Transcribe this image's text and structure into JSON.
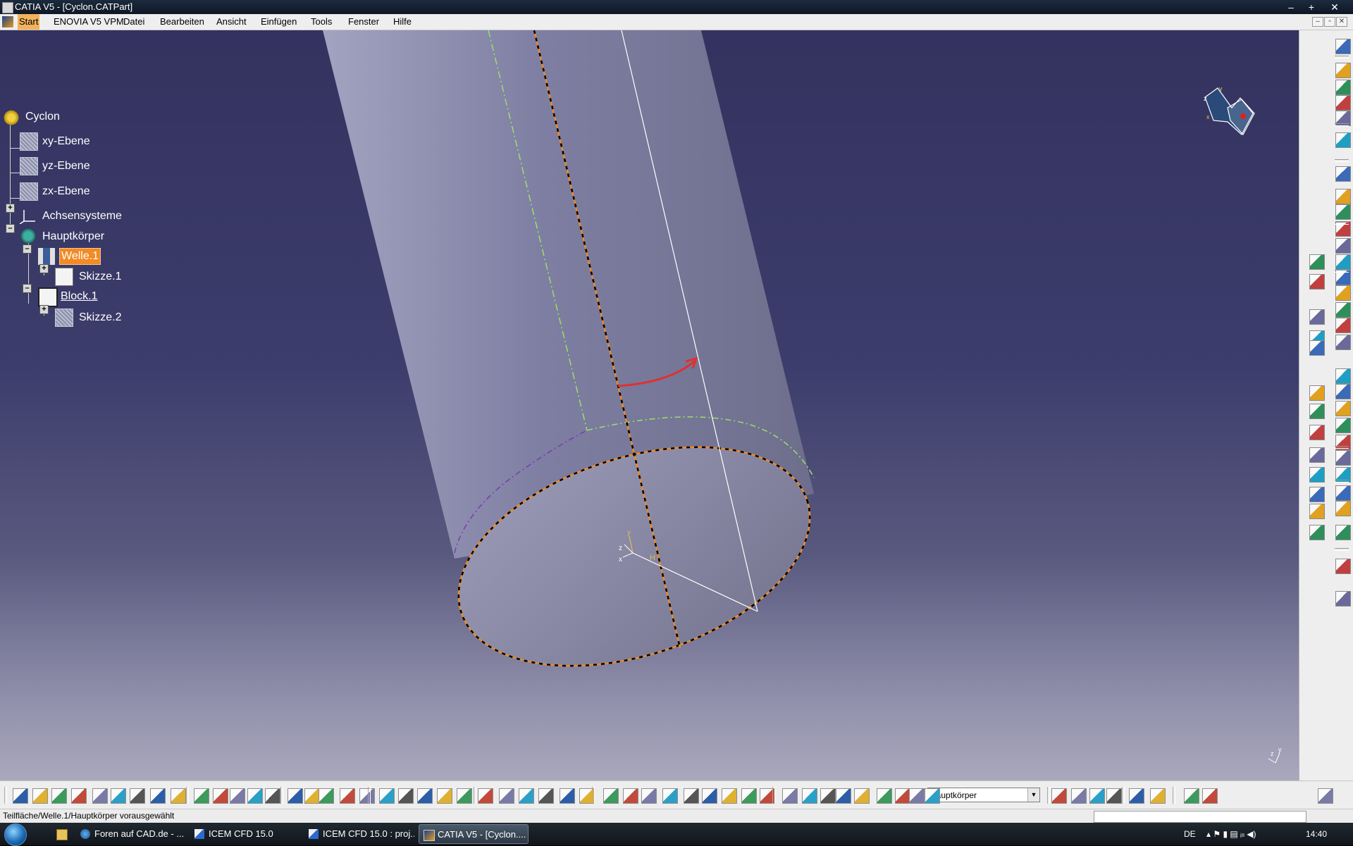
{
  "window": {
    "title": "CATIA V5 - [Cyclon.CATPart]",
    "controls": [
      "–",
      "+",
      "✕"
    ]
  },
  "menu": {
    "items": [
      "Start",
      "ENOVIA V5 VPM",
      "Datei",
      "Bearbeiten",
      "Ansicht",
      "Einfügen",
      "Tools",
      "Fenster",
      "Hilfe"
    ],
    "mdi_controls": [
      "–",
      "▫",
      "✕"
    ]
  },
  "spec_tree": {
    "root": "Cyclon",
    "planes": [
      "xy-Ebene",
      "yz-Ebene",
      "zx-Ebene"
    ],
    "axis_systems": "Achsensysteme",
    "main_body": "Hauptkörper",
    "shaft": "Welle.1",
    "shaft_sketch": "Skizze.1",
    "pad": "Block.1",
    "pad_sketch": "Skizze.2"
  },
  "compass_axes": {
    "x": "x",
    "y": "y",
    "z": "z"
  },
  "sketch_label": "H",
  "bottom_toolbar": {
    "body_select_value": "Hauptkörper"
  },
  "status": {
    "text": "Teilfläche/Welle.1/Hauptkörper vorausgewählt"
  },
  "taskbar": {
    "items": [
      {
        "label": "Foren auf CAD.de - ...",
        "icon": "browser-icon"
      },
      {
        "label": "ICEM CFD 15.0",
        "icon": "icem-icon"
      },
      {
        "label": "ICEM CFD 15.0 : proj...",
        "icon": "icem-icon"
      },
      {
        "label": "CATIA V5 - [Cyclon....",
        "icon": "catia-icon"
      }
    ],
    "language": "DE",
    "clock": "14:40"
  },
  "colors": {
    "viewport_top": "#34325f",
    "viewport_bottom": "#a9a8bd",
    "selection": "#f28a25",
    "menu_active": "#f3b25b",
    "highlight_edge": "#e8892b",
    "arrow": "#e03030"
  }
}
